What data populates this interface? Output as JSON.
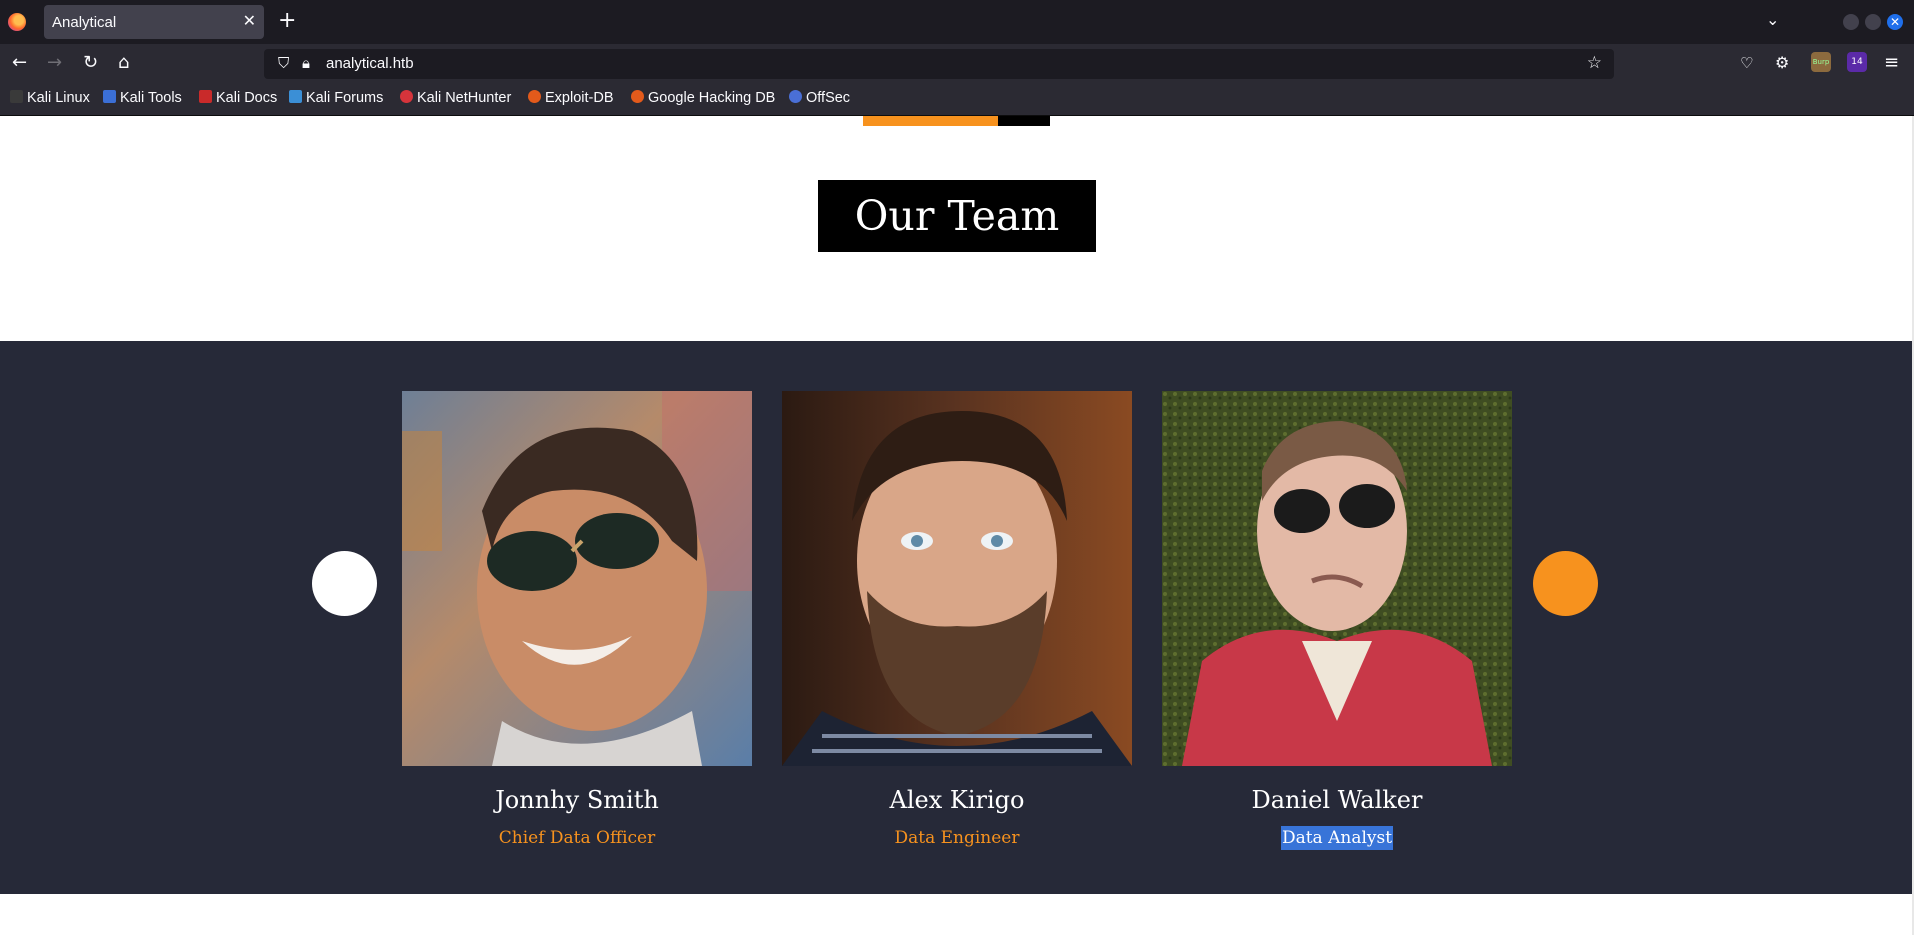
{
  "browser": {
    "tab_title": "Analytical",
    "url": "analytical.htb",
    "bookmarks": [
      "Kali Linux",
      "Kali Tools",
      "Kali Docs",
      "Kali Forums",
      "Kali NetHunter",
      "Exploit-DB",
      "Google Hacking DB",
      "OffSec"
    ],
    "extension_badge": "14",
    "burp_badge": "Burp"
  },
  "page": {
    "section_heading": "Our Team",
    "accent_color": "#f7921e",
    "team_bg_color": "#262938",
    "members": [
      {
        "name": "Jonnhy Smith",
        "role": "Chief Data Officer"
      },
      {
        "name": "Alex Kirigo",
        "role": "Data Engineer"
      },
      {
        "name": "Daniel Walker",
        "role": "Data Analyst"
      }
    ]
  }
}
